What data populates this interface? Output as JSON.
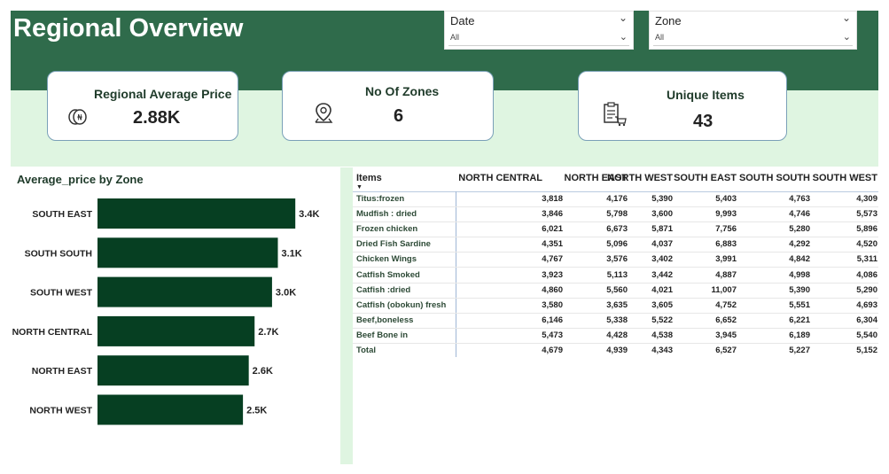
{
  "header": {
    "title": "Regional Overview"
  },
  "slicers": [
    {
      "label": "Date",
      "value": "All"
    },
    {
      "label": "Zone",
      "value": "All"
    }
  ],
  "cards": [
    {
      "title": "Regional Average Price",
      "value": "2.88K",
      "icon": "coins-icon"
    },
    {
      "title": "No Of Zones",
      "value": "6",
      "icon": "map-pin-icon"
    },
    {
      "title": "Unique Items",
      "value": "43",
      "icon": "checklist-cart-icon"
    }
  ],
  "colors": {
    "header_dark_green": "#2f6b4b",
    "light_green": "#dff5e1",
    "bar_green": "#063f22",
    "card_border": "#7aa0b8"
  },
  "chart_data": {
    "type": "bar",
    "orientation": "horizontal",
    "title": "Average_price by Zone",
    "categories": [
      "SOUTH EAST",
      "SOUTH SOUTH",
      "SOUTH WEST",
      "NORTH CENTRAL",
      "NORTH EAST",
      "NORTH WEST"
    ],
    "values": [
      3.4,
      3.1,
      3.0,
      2.7,
      2.6,
      2.5
    ],
    "data_labels": [
      "3.4K",
      "3.1K",
      "3.0K",
      "2.7K",
      "2.6K",
      "2.5K"
    ],
    "unit": "K",
    "xlim": [
      0,
      3.9
    ],
    "grid": false,
    "legend": "none"
  },
  "table": {
    "item_header": "Items",
    "columns": [
      "NORTH CENTRAL",
      "NORTH EAST",
      "NORTH WEST",
      "SOUTH EAST",
      "SOUTH SOUTH",
      "SOUTH WEST"
    ],
    "rows": [
      {
        "item": "Titus:frozen",
        "values": [
          "3,818",
          "4,176",
          "5,390",
          "5,403",
          "4,763",
          "4,309"
        ]
      },
      {
        "item": "Mudfish : dried",
        "values": [
          "3,846",
          "5,798",
          "3,600",
          "9,993",
          "4,746",
          "5,573"
        ]
      },
      {
        "item": "Frozen chicken",
        "values": [
          "6,021",
          "6,673",
          "5,871",
          "7,756",
          "5,280",
          "5,896"
        ]
      },
      {
        "item": "Dried Fish Sardine",
        "values": [
          "4,351",
          "5,096",
          "4,037",
          "6,883",
          "4,292",
          "4,520"
        ]
      },
      {
        "item": "Chicken Wings",
        "values": [
          "4,767",
          "3,576",
          "3,402",
          "3,991",
          "4,842",
          "5,311"
        ]
      },
      {
        "item": "Catfish Smoked",
        "values": [
          "3,923",
          "5,113",
          "3,442",
          "4,887",
          "4,998",
          "4,086"
        ]
      },
      {
        "item": "Catfish :dried",
        "values": [
          "4,860",
          "5,560",
          "4,021",
          "11,007",
          "5,390",
          "5,290"
        ]
      },
      {
        "item": "Catfish (obokun) fresh",
        "values": [
          "3,580",
          "3,635",
          "3,605",
          "4,752",
          "5,551",
          "4,693"
        ]
      },
      {
        "item": "Beef,boneless",
        "values": [
          "6,146",
          "5,338",
          "5,522",
          "6,652",
          "6,221",
          "6,304"
        ]
      },
      {
        "item": "Beef Bone in",
        "values": [
          "5,473",
          "4,428",
          "4,538",
          "3,945",
          "6,189",
          "5,540"
        ]
      },
      {
        "item": "Total",
        "values": [
          "4,679",
          "4,939",
          "4,343",
          "6,527",
          "5,227",
          "5,152"
        ]
      }
    ]
  }
}
